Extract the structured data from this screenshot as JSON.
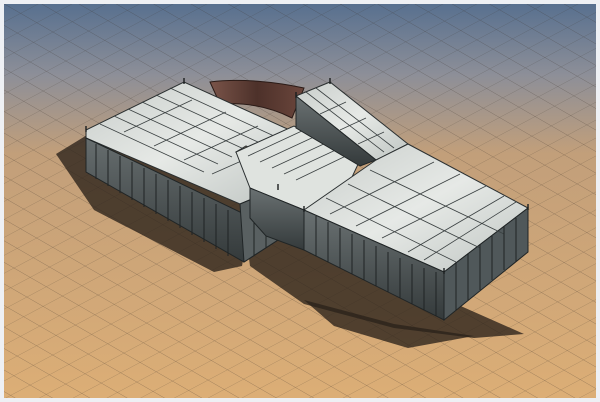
{
  "scene": {
    "subject": "render-of-modular-panel-structure",
    "colors": {
      "sky_top": "#5a7294",
      "sky_mid": "#b9a288",
      "ground": "#d9aa72",
      "grid_line": "#2e2a24",
      "panel_top": "#d7dcd8",
      "panel_top_light": "#eef1ee",
      "panel_side": "#5f6667",
      "panel_side_dark": "#3c4243",
      "bridge": "#5a3b33",
      "shadow": "#2a2119"
    }
  }
}
